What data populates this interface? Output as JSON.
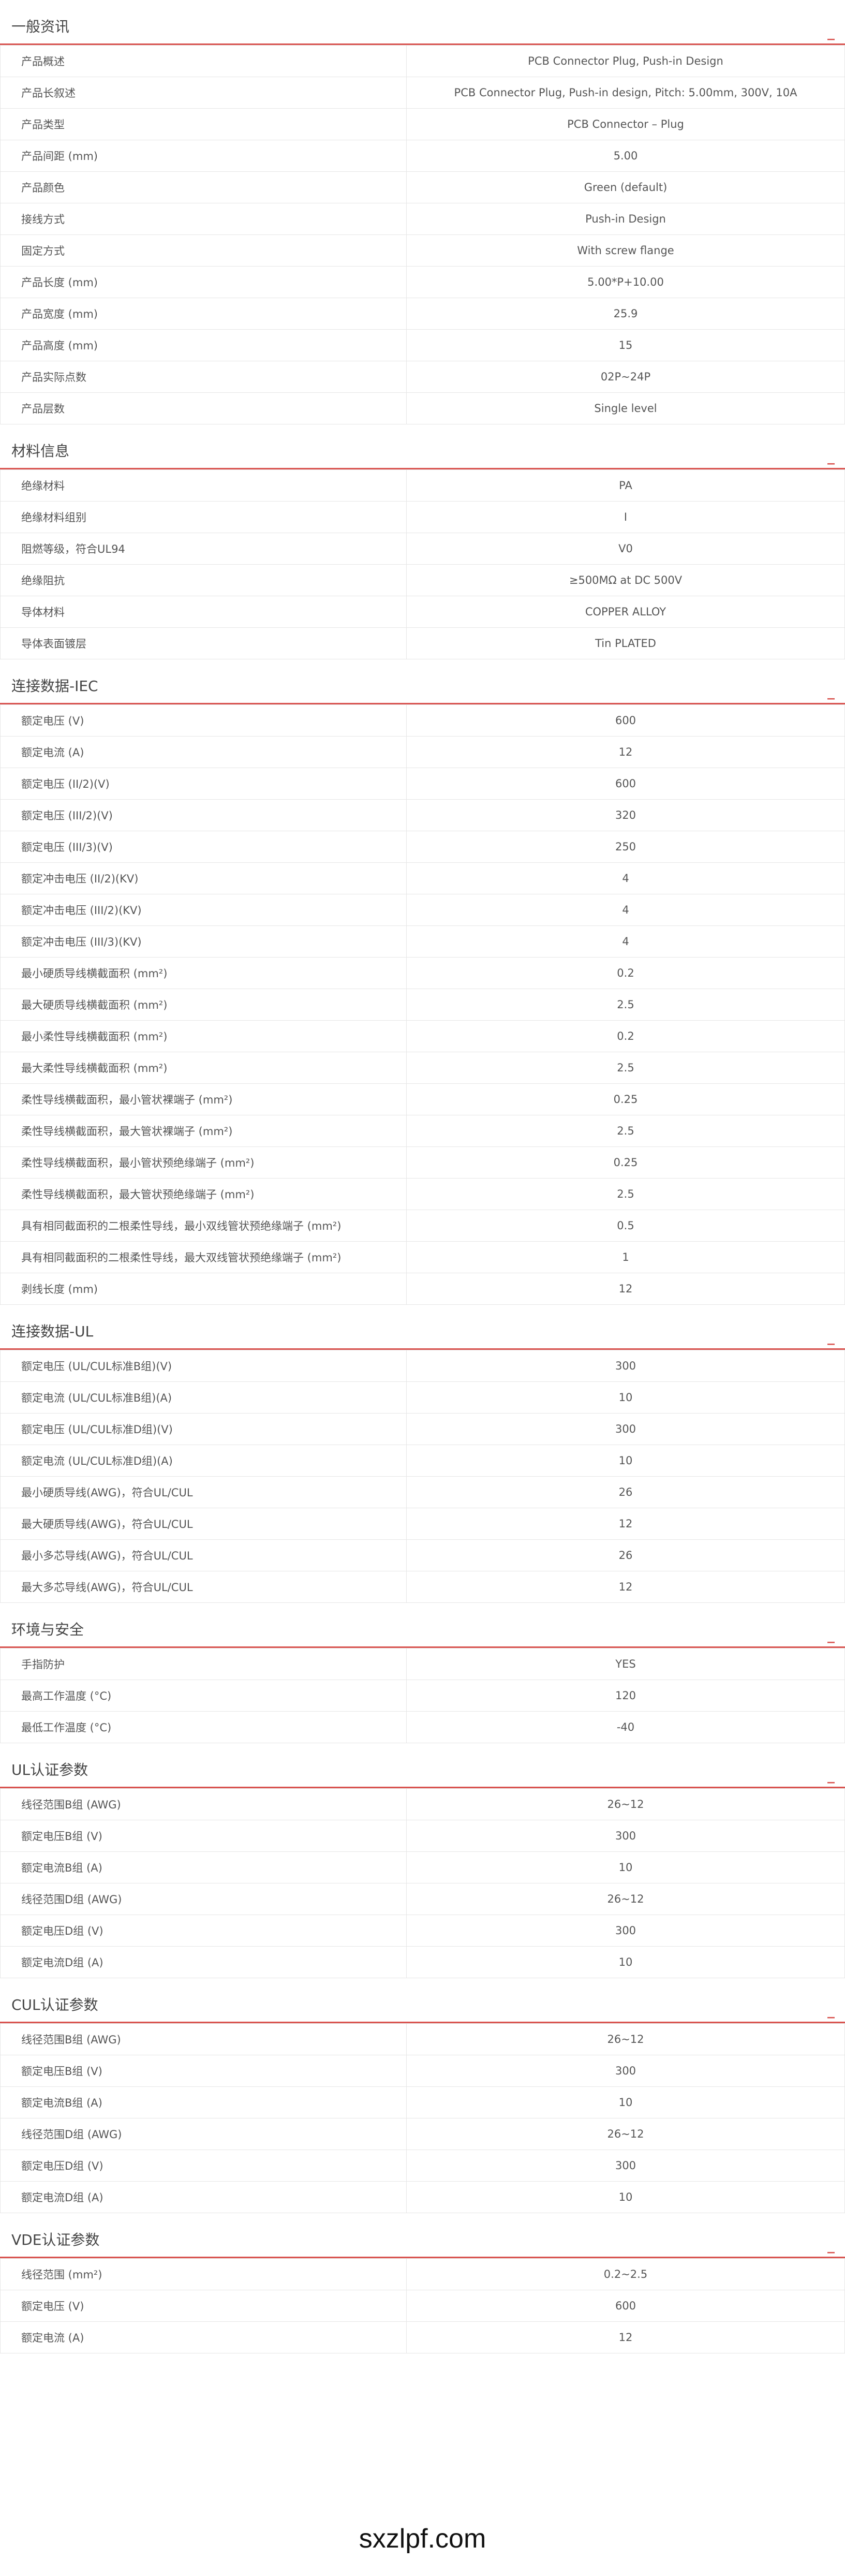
{
  "sections": [
    {
      "id": "general",
      "title": "一般资讯",
      "toggle": "_",
      "rows": [
        {
          "label": "产品概述",
          "value": "PCB Connector Plug, Push-in Design"
        },
        {
          "label": "产品长叙述",
          "value": "PCB Connector Plug, Push-in design, Pitch: 5.00mm, 300V, 10A"
        },
        {
          "label": "产品类型",
          "value": "PCB Connector – Plug"
        },
        {
          "label": "产品间距 (mm)",
          "value": "5.00"
        },
        {
          "label": "产品颜色",
          "value": "Green (default)"
        },
        {
          "label": "接线方式",
          "value": "Push-in Design"
        },
        {
          "label": "固定方式",
          "value": "With screw flange"
        },
        {
          "label": "产品长度 (mm)",
          "value": "5.00*P+10.00"
        },
        {
          "label": "产品宽度 (mm)",
          "value": "25.9"
        },
        {
          "label": "产品高度 (mm)",
          "value": "15"
        },
        {
          "label": "产品实际点数",
          "value": "02P~24P"
        },
        {
          "label": "产品层数",
          "value": "Single level"
        }
      ]
    },
    {
      "id": "material",
      "title": "材料信息",
      "toggle": "_",
      "rows": [
        {
          "label": "绝缘材料",
          "value": "PA"
        },
        {
          "label": "绝缘材料组别",
          "value": "I"
        },
        {
          "label": "阻燃等级，符合UL94",
          "value": "V0"
        },
        {
          "label": "绝缘阻抗",
          "value": "≥500MΩ at DC 500V"
        },
        {
          "label": "导体材料",
          "value": "COPPER ALLOY"
        },
        {
          "label": "导体表面镀层",
          "value": "Tin PLATED"
        }
      ]
    },
    {
      "id": "iec",
      "title": "连接数据-IEC",
      "toggle": "_",
      "rows": [
        {
          "label": "额定电压 (V)",
          "value": "600"
        },
        {
          "label": "额定电流 (A)",
          "value": "12"
        },
        {
          "label": "额定电压 (II/2)(V)",
          "value": "600"
        },
        {
          "label": "额定电压 (III/2)(V)",
          "value": "320"
        },
        {
          "label": "额定电压 (III/3)(V)",
          "value": "250"
        },
        {
          "label": "额定冲击电压 (II/2)(KV)",
          "value": "4"
        },
        {
          "label": "额定冲击电压 (III/2)(KV)",
          "value": "4"
        },
        {
          "label": "额定冲击电压 (III/3)(KV)",
          "value": "4"
        },
        {
          "label": "最小硬质导线横截面积 (mm²)",
          "value": "0.2"
        },
        {
          "label": "最大硬质导线横截面积 (mm²)",
          "value": "2.5"
        },
        {
          "label": "最小柔性导线横截面积 (mm²)",
          "value": "0.2"
        },
        {
          "label": "最大柔性导线横截面积 (mm²)",
          "value": "2.5"
        },
        {
          "label": "柔性导线横截面积，最小管状裸端子 (mm²)",
          "value": "0.25"
        },
        {
          "label": "柔性导线横截面积，最大管状裸端子 (mm²)",
          "value": "2.5"
        },
        {
          "label": "柔性导线横截面积，最小管状预绝缘端子 (mm²)",
          "value": "0.25"
        },
        {
          "label": "柔性导线横截面积，最大管状预绝缘端子 (mm²)",
          "value": "2.5"
        },
        {
          "label": "具有相同截面积的二根柔性导线，最小双线管状预绝缘端子 (mm²)",
          "value": "0.5"
        },
        {
          "label": "具有相同截面积的二根柔性导线，最大双线管状预绝缘端子 (mm²)",
          "value": "1"
        },
        {
          "label": "剥线长度 (mm)",
          "value": "12"
        }
      ]
    },
    {
      "id": "ul-data",
      "title": "连接数据-UL",
      "toggle": "_",
      "rows": [
        {
          "label": "额定电压 (UL/CUL标准B组)(V)",
          "value": "300"
        },
        {
          "label": "额定电流 (UL/CUL标准B组)(A)",
          "value": "10"
        },
        {
          "label": "额定电压 (UL/CUL标准D组)(V)",
          "value": "300"
        },
        {
          "label": "额定电流 (UL/CUL标准D组)(A)",
          "value": "10"
        },
        {
          "label": "最小硬质导线(AWG)，符合UL/CUL",
          "value": "26"
        },
        {
          "label": "最大硬质导线(AWG)，符合UL/CUL",
          "value": "12"
        },
        {
          "label": "最小多芯导线(AWG)，符合UL/CUL",
          "value": "26"
        },
        {
          "label": "最大多芯导线(AWG)，符合UL/CUL",
          "value": "12"
        }
      ]
    },
    {
      "id": "environment",
      "title": "环境与安全",
      "toggle": "_",
      "rows": [
        {
          "label": "手指防护",
          "value": "YES"
        },
        {
          "label": "最高工作温度 (°C)",
          "value": "120"
        },
        {
          "label": "最低工作温度 (°C)",
          "value": "-40"
        }
      ]
    },
    {
      "id": "ul-cert",
      "title": "UL认证参数",
      "toggle": "_",
      "rows": [
        {
          "label": "线径范围B组 (AWG)",
          "value": "26~12"
        },
        {
          "label": "额定电压B组 (V)",
          "value": "300"
        },
        {
          "label": "额定电流B组 (A)",
          "value": "10"
        },
        {
          "label": "线径范围D组 (AWG)",
          "value": "26~12"
        },
        {
          "label": "额定电压D组 (V)",
          "value": "300"
        },
        {
          "label": "额定电流D组 (A)",
          "value": "10"
        }
      ]
    },
    {
      "id": "cul-cert",
      "title": "CUL认证参数",
      "toggle": "_",
      "rows": [
        {
          "label": "线径范围B组 (AWG)",
          "value": "26~12"
        },
        {
          "label": "额定电压B组 (V)",
          "value": "300"
        },
        {
          "label": "额定电流B组 (A)",
          "value": "10"
        },
        {
          "label": "线径范围D组 (AWG)",
          "value": "26~12"
        },
        {
          "label": "额定电压D组 (V)",
          "value": "300"
        },
        {
          "label": "额定电流D组 (A)",
          "value": "10"
        }
      ]
    },
    {
      "id": "vde-cert",
      "title": "VDE认证参数",
      "toggle": "_",
      "rows": [
        {
          "label": "线径范围 (mm²)",
          "value": "0.2~2.5"
        },
        {
          "label": "额定电压 (V)",
          "value": "600"
        },
        {
          "label": "额定电流 (A)",
          "value": "12"
        }
      ]
    }
  ],
  "footer": {
    "brand": "sxzlpf.com"
  }
}
